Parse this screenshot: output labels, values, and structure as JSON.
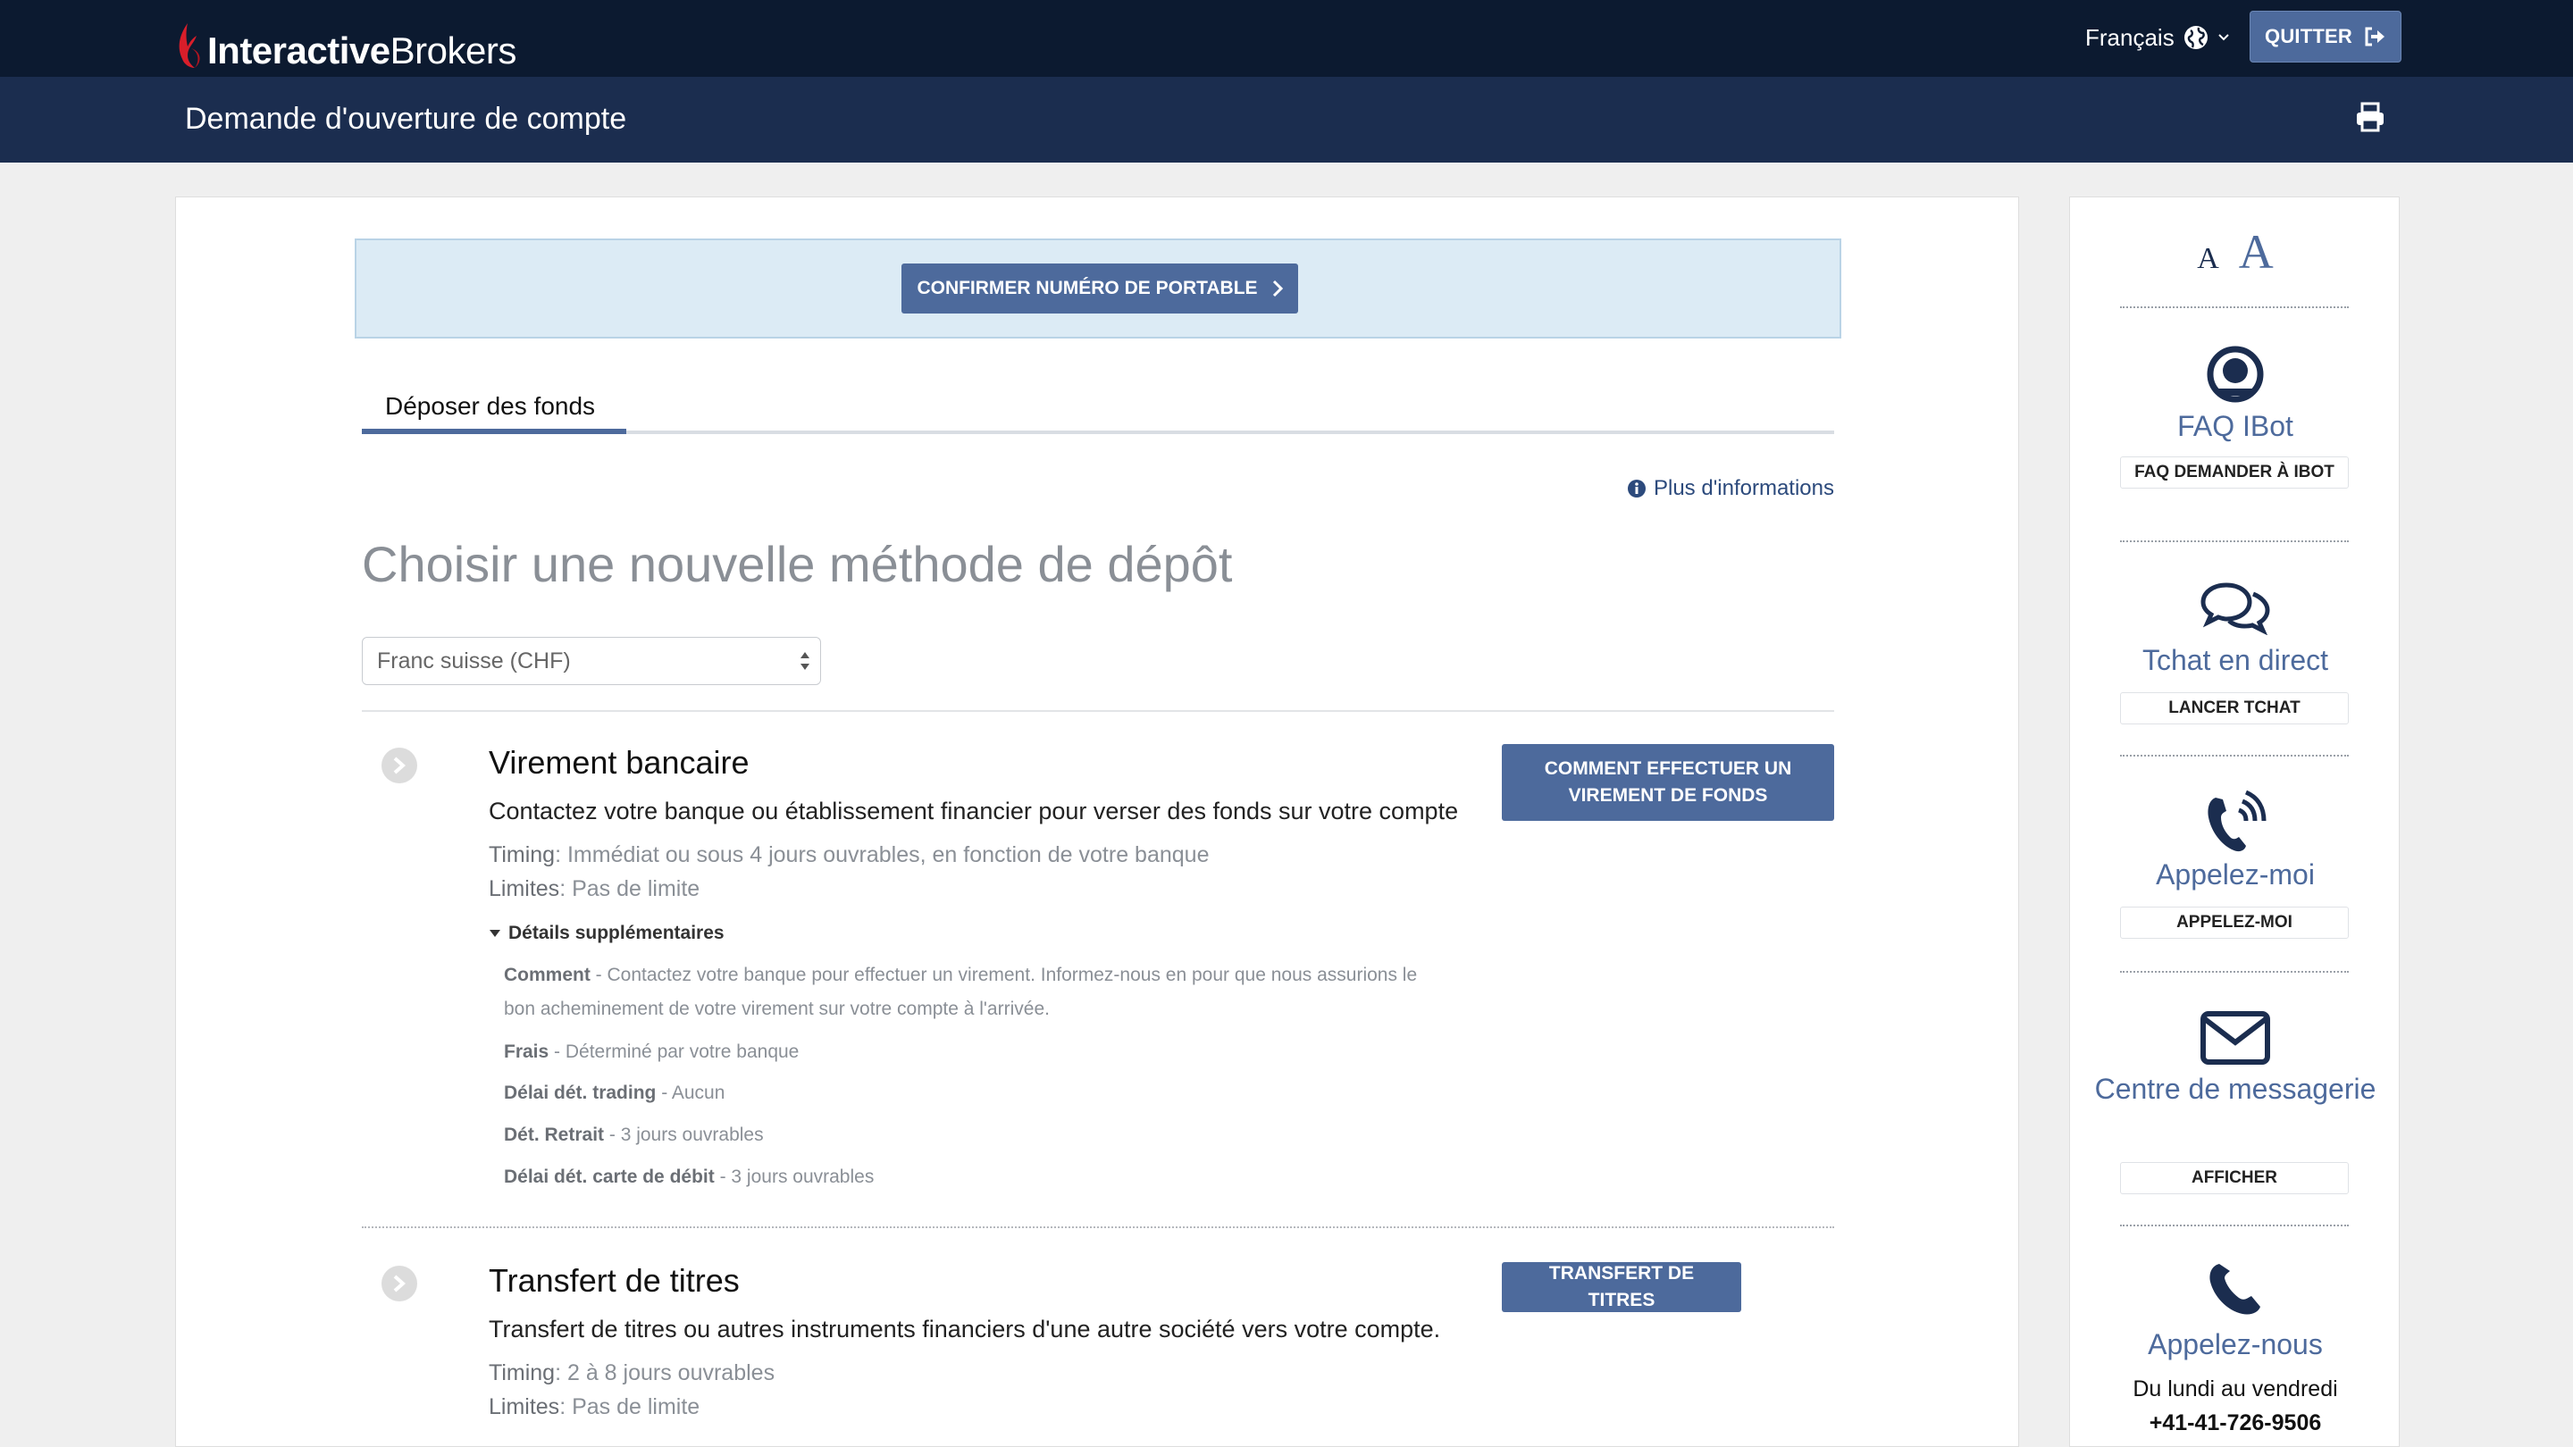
{
  "header": {
    "logo_bold": "Interactive",
    "logo_regular": "Brokers",
    "language": "Français",
    "quit_label": "QUITTER"
  },
  "subheader": {
    "title": "Demande d'ouverture de compte"
  },
  "confirm": {
    "button_label": "CONFIRMER NUMÉRO DE PORTABLE"
  },
  "tabs": [
    {
      "label": "Déposer des fonds",
      "active": true
    }
  ],
  "more_info": "Plus d'informations",
  "heading": "Choisir une nouvelle méthode de dépôt",
  "currency_select": {
    "value": "Franc suisse (CHF)"
  },
  "methods": [
    {
      "title": "Virement bancaire",
      "description": "Contactez votre banque ou établissement financier pour verser des fonds sur votre compte",
      "timing_label": "Timing",
      "timing_value": ": Immédiat ou sous 4 jours ouvrables, en fonction de votre banque",
      "limits_label": "Limites",
      "limits_value": ": Pas de limite",
      "button_label": "COMMENT EFFECTUER UN VIREMENT DE FONDS",
      "details_label": "Détails supplémentaires",
      "details": [
        {
          "label": "Comment",
          "text": " - Contactez votre banque pour effectuer un virement. Informez-nous en pour que nous assurions le bon acheminement de votre virement sur votre compte à l'arrivée."
        },
        {
          "label": "Frais",
          "text": " - Déterminé par votre banque"
        },
        {
          "label": "Délai dét. trading",
          "text": " - Aucun"
        },
        {
          "label": "Dét. Retrait",
          "text": " - 3 jours ouvrables"
        },
        {
          "label": "Délai dét. carte de débit",
          "text": " - 3 jours ouvrables"
        }
      ]
    },
    {
      "title": "Transfert de titres",
      "description": "Transfert de titres ou autres instruments financiers d'une autre société vers votre compte.",
      "timing_label": "Timing",
      "timing_value": ": 2 à 8 jours ouvrables",
      "limits_label": "Limites",
      "limits_value": ": Pas de limite",
      "button_label": "TRANSFERT DE TITRES"
    }
  ],
  "sidebar": {
    "font_small": "A",
    "font_large": "A",
    "items": [
      {
        "title": "FAQ IBot",
        "button": "FAQ DEMANDER À IBOT",
        "icon": "ibot-icon"
      },
      {
        "title": "Tchat en direct",
        "button": "LANCER TCHAT",
        "icon": "chat-icon"
      },
      {
        "title": "Appelez-moi",
        "button": "APPELEZ-MOI",
        "icon": "phone-ring-icon"
      },
      {
        "title": "Centre de messagerie",
        "button": "AFFICHER",
        "icon": "envelope-icon"
      },
      {
        "title": "Appelez-nous",
        "icon": "phone-icon",
        "hours": "Du lundi au vendredi",
        "phone": "+41-41-726-9506"
      }
    ]
  },
  "colors": {
    "navbar": "#0c1a30",
    "subbar": "#1b2d4f",
    "accent": "#4d6a9c",
    "confirm_bg": "#dcebf5"
  }
}
